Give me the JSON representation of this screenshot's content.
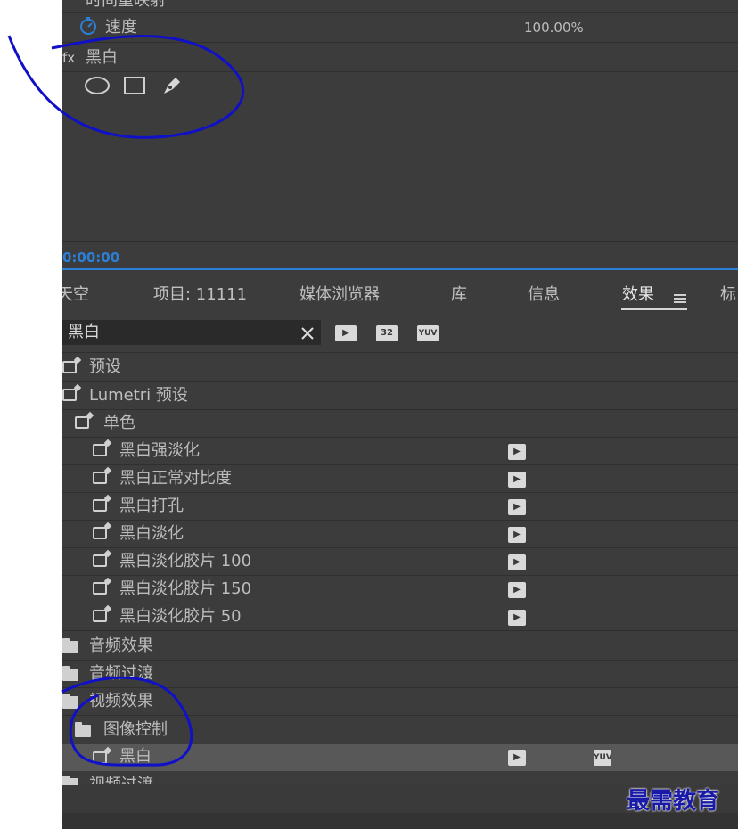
{
  "effect_controls": {
    "cut_title": "时间重映射",
    "speed_label": "速度",
    "speed_value": "100.00%",
    "fx_label": "fx",
    "effect_name": "黑白"
  },
  "timecode": "0:00:00",
  "tabs": [
    {
      "label": "天空"
    },
    {
      "label": "项目: 11111"
    },
    {
      "label": "媒体浏览器"
    },
    {
      "label": "库"
    },
    {
      "label": "信息"
    },
    {
      "label": "效果"
    },
    {
      "label": "标"
    }
  ],
  "search": {
    "value": "黑白"
  },
  "filter_badges": [
    "32",
    "YUV"
  ],
  "tree": [
    {
      "label": "预设"
    },
    {
      "label": "Lumetri 预设"
    },
    {
      "label": "单色"
    },
    {
      "label": "黑白强淡化"
    },
    {
      "label": "黑白正常对比度"
    },
    {
      "label": "黑白打孔"
    },
    {
      "label": "黑白淡化"
    },
    {
      "label": "黑白淡化胶片 100"
    },
    {
      "label": "黑白淡化胶片 150"
    },
    {
      "label": "黑白淡化胶片 50"
    },
    {
      "label": "音频效果"
    },
    {
      "label": "音频过渡"
    },
    {
      "label": "视频效果"
    },
    {
      "label": "图像控制"
    },
    {
      "label": "黑白"
    },
    {
      "label": "视频过渡"
    }
  ],
  "watermark": "最需教育",
  "colors": {
    "panel_bg": "#3c3c3c",
    "accent_blue": "#2c7fd6",
    "annotation_ink": "#1010c8"
  }
}
